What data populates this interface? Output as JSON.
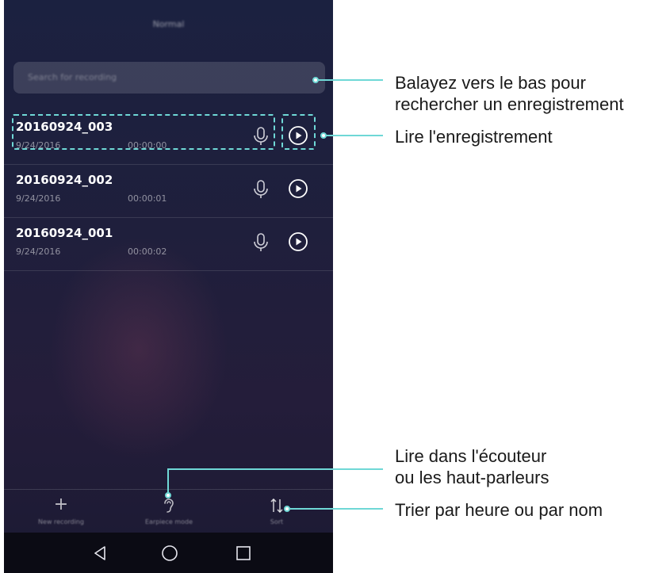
{
  "header": {
    "title": "Normal"
  },
  "search": {
    "placeholder": "Search for recording"
  },
  "recordings": [
    {
      "name": "20160924_003",
      "date": "9/24/2016",
      "duration": "00:00:00"
    },
    {
      "name": "20160924_002",
      "date": "9/24/2016",
      "duration": "00:00:01"
    },
    {
      "name": "20160924_001",
      "date": "9/24/2016",
      "duration": "00:00:02"
    }
  ],
  "toolbar": {
    "new_label": "New recording",
    "earpiece_label": "Earpiece mode",
    "sort_label": "Sort"
  },
  "icons": {
    "new": "plus-icon",
    "earpiece": "ear-icon",
    "sort": "sort-icon",
    "mic": "microphone-icon",
    "play": "play-icon",
    "nav_back": "back-icon",
    "nav_home": "home-icon",
    "nav_recent": "recent-apps-icon"
  },
  "annotations": {
    "search_line1": "Balayez vers le bas pour",
    "search_line2": "rechercher un enregistrement",
    "play": "Lire l'enregistrement",
    "earpiece_line1": "Lire dans l'écouteur",
    "earpiece_line2": "ou les haut-parleurs",
    "sort": "Trier par heure ou par nom"
  },
  "colors": {
    "accent": "#6fd8d6",
    "background_top": "#1b2140",
    "background_bottom": "#1b1a33",
    "text_primary": "#ffffff"
  }
}
